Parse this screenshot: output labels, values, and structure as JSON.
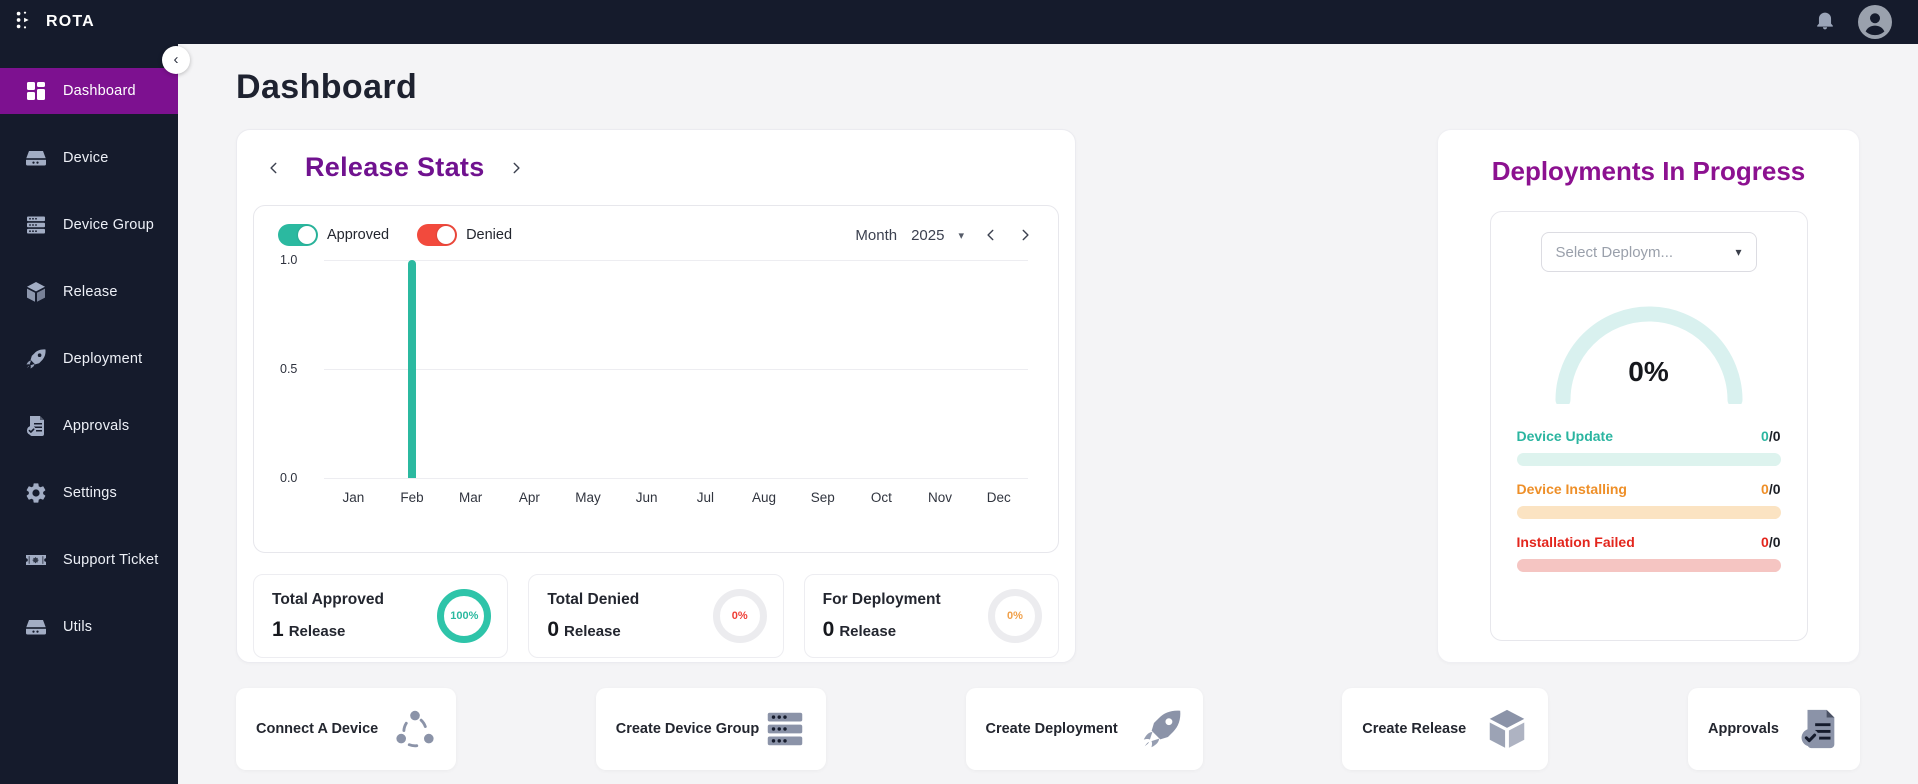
{
  "topbar": {
    "brand": "ROTA"
  },
  "sidebar": {
    "items": [
      {
        "label": "Dashboard",
        "icon": "dashboard",
        "active": true
      },
      {
        "label": "Device",
        "icon": "harddrive",
        "active": false
      },
      {
        "label": "Device Group",
        "icon": "server",
        "active": false
      },
      {
        "label": "Release",
        "icon": "cube",
        "active": false
      },
      {
        "label": "Deployment",
        "icon": "rocket",
        "active": false
      },
      {
        "label": "Approvals",
        "icon": "doccheck",
        "active": false
      },
      {
        "label": "Settings",
        "icon": "gear",
        "active": false
      },
      {
        "label": "Support Ticket",
        "icon": "ticket",
        "active": false
      },
      {
        "label": "Utils",
        "icon": "harddrive",
        "active": false
      }
    ]
  },
  "page": {
    "title": "Dashboard"
  },
  "release_stats": {
    "title": "Release Stats",
    "toggles": [
      {
        "label": "Approved",
        "color": "#2bb9a0",
        "on": true
      },
      {
        "label": "Denied",
        "color": "#f24a3d",
        "on": true
      }
    ],
    "month_label": "Month",
    "year": "2025",
    "chart_data": {
      "type": "bar",
      "categories": [
        "Jan",
        "Feb",
        "Mar",
        "Apr",
        "May",
        "Jun",
        "Jul",
        "Aug",
        "Sep",
        "Oct",
        "Nov",
        "Dec"
      ],
      "series": [
        {
          "name": "Approved",
          "color": "#2bb9a0",
          "values": [
            0,
            1,
            0,
            0,
            0,
            0,
            0,
            0,
            0,
            0,
            0,
            0
          ]
        },
        {
          "name": "Denied",
          "color": "#f24a3d",
          "values": [
            0,
            0,
            0,
            0,
            0,
            0,
            0,
            0,
            0,
            0,
            0,
            0
          ]
        }
      ],
      "yticks": [
        0.0,
        0.5,
        1.0
      ],
      "ylim": [
        0,
        1
      ],
      "grid": true
    },
    "stat_cards": [
      {
        "title": "Total Approved",
        "count": "1",
        "unit": "Release",
        "percent": "100%",
        "ring_color": "#2ec4a9",
        "percent_color": "#2bb9a0"
      },
      {
        "title": "Total Denied",
        "count": "0",
        "unit": "Release",
        "percent": "0%",
        "ring_color": "#ececef",
        "percent_color": "#ef3e36"
      },
      {
        "title": "For Deployment",
        "count": "0",
        "unit": "Release",
        "percent": "0%",
        "ring_color": "#ececef",
        "percent_color": "#f0a04a"
      }
    ]
  },
  "deployments": {
    "title": "Deployments In Progress",
    "select_placeholder": "Select Deploym...",
    "gauge_percent": "0%",
    "gauge_color": "#d9f1ef",
    "rows": [
      {
        "label": "Device Update",
        "value": "0",
        "total": "/0",
        "color": "#2bb5a0",
        "bar": "#ddf3ee"
      },
      {
        "label": "Device Installing",
        "value": "0",
        "total": "/0",
        "color": "#ee8f28",
        "bar": "#fbe3c2"
      },
      {
        "label": "Installation Failed",
        "value": "0",
        "total": "/0",
        "color": "#e3261d",
        "bar": "#f5c5c2"
      }
    ]
  },
  "quick_actions": [
    {
      "label": "Connect A Device",
      "icon": "sharenodes"
    },
    {
      "label": "Create Device Group",
      "icon": "server"
    },
    {
      "label": "Create Deployment",
      "icon": "rocket"
    },
    {
      "label": "Create Release",
      "icon": "cube"
    },
    {
      "label": "Approvals",
      "icon": "doccheck"
    }
  ]
}
